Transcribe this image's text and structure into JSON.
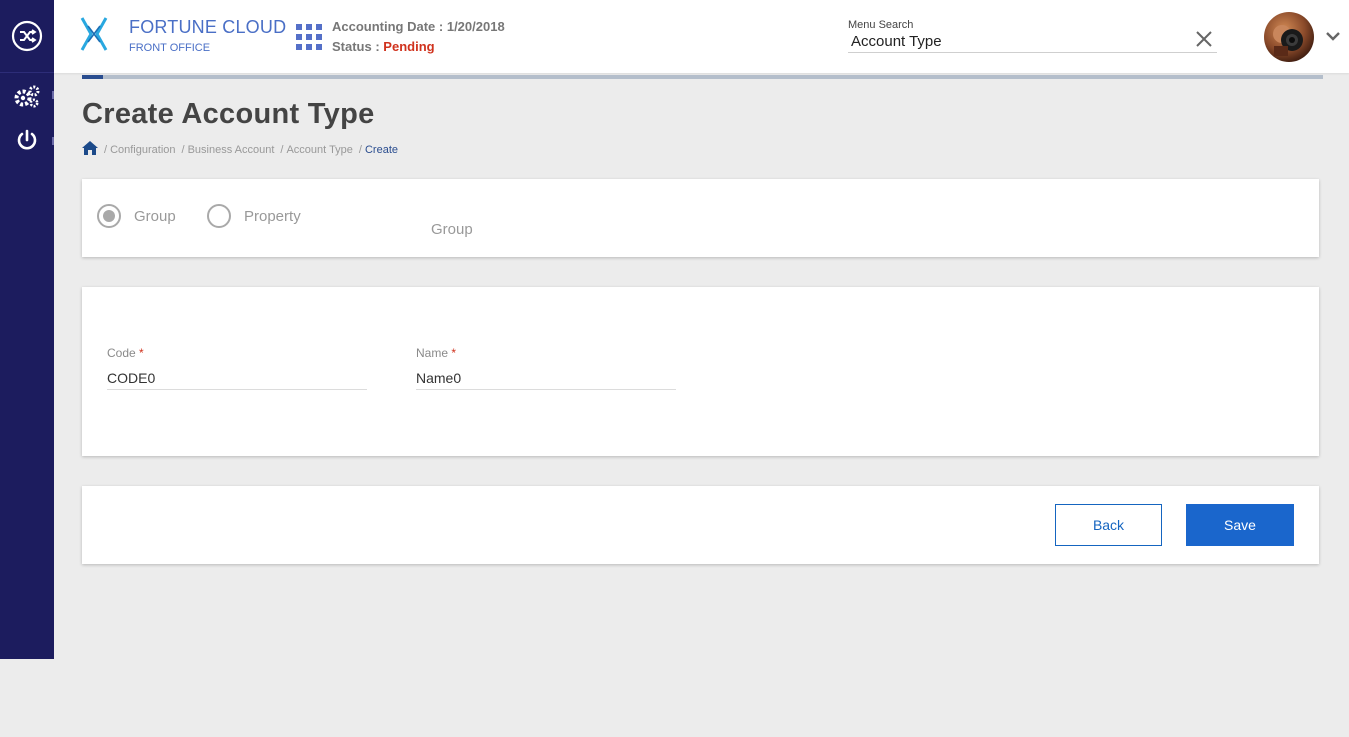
{
  "header": {
    "brand": "FORTUNE CLOUD",
    "brand_sub": "FRONT OFFICE",
    "accounting_label": "Accounting Date : ",
    "accounting_date": "1/20/2018",
    "status_label": "Status : ",
    "status_value": "Pending",
    "menu_search_label": "Menu Search",
    "menu_search_value": "Account Type"
  },
  "page": {
    "title": "Create Account Type",
    "breadcrumb": [
      "Configuration",
      "Business Account",
      "Account Type",
      "Create"
    ]
  },
  "type_selector": {
    "options": [
      "Group",
      "Property"
    ],
    "selected": "Group",
    "selected_display": "Group"
  },
  "form": {
    "code_label": "Code",
    "code_value": "CODE0",
    "name_label": "Name",
    "name_value": "Name0",
    "required_marker": "*"
  },
  "actions": {
    "back_label": "Back",
    "save_label": "Save"
  },
  "progress": {
    "fraction": 0.017
  },
  "icons": {
    "sidebar": [
      "shuffle-icon",
      "gears-icon",
      "power-icon"
    ],
    "header": [
      "logo-icon",
      "apps-grid-icon",
      "close-icon",
      "chevron-down-icon"
    ],
    "breadcrumb": [
      "home-icon"
    ]
  },
  "colors": {
    "sidebar": "#1c1c5e",
    "brand": "#4a6fc6",
    "status_pending": "#d0321d",
    "primary": "#1a66cc",
    "page_bg": "#ececec"
  }
}
